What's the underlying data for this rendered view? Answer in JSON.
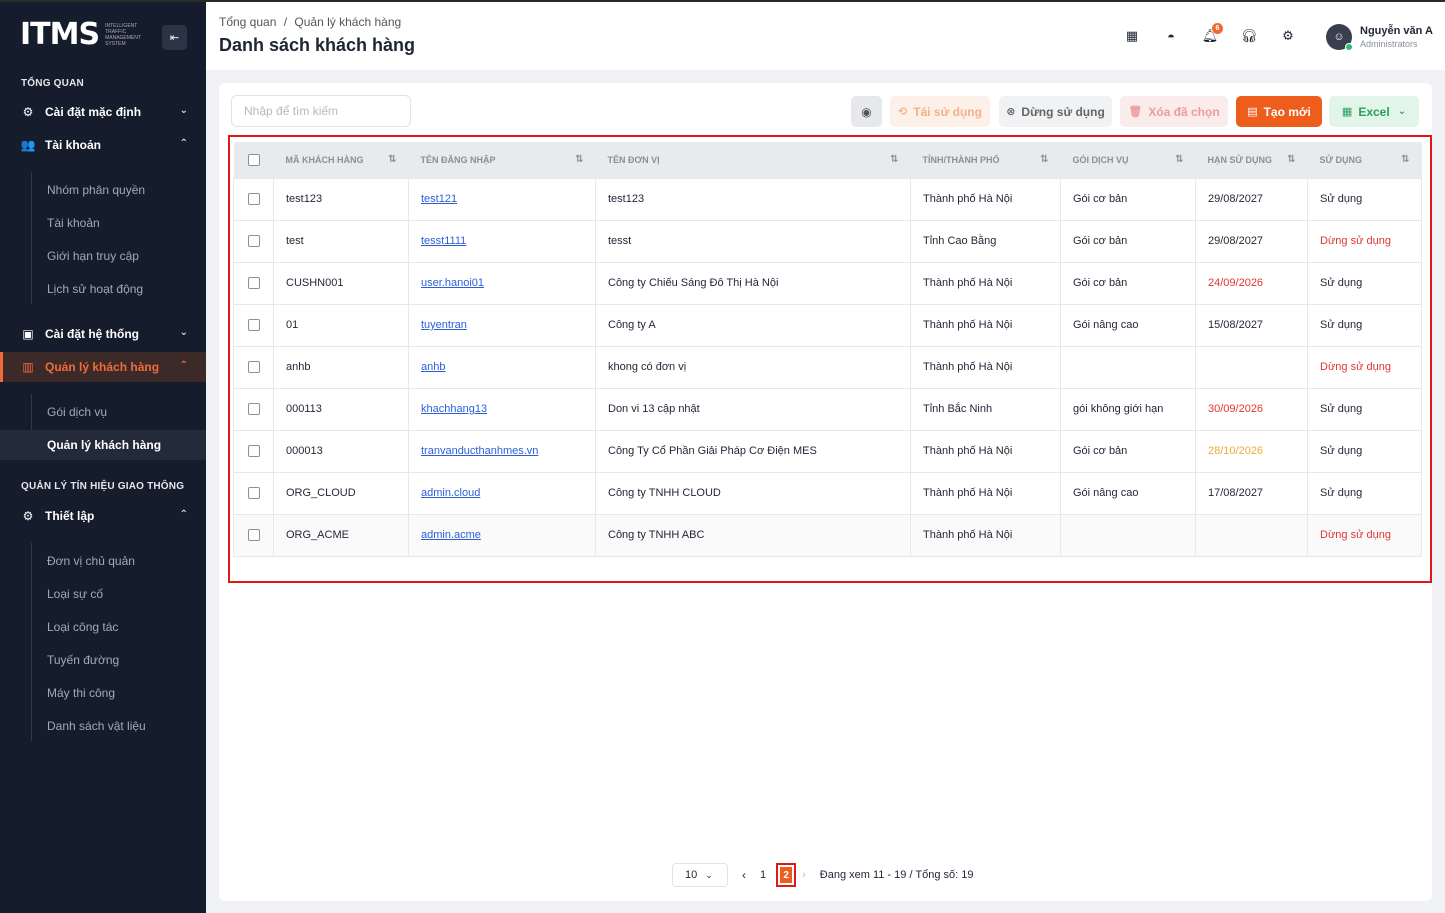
{
  "sidebar": {
    "logo_text": "ITMS",
    "logo_sub": "Intelligent Traffic Management System",
    "section_overview": "TỔNG QUAN",
    "menu_default_settings": "Cài đặt mặc định",
    "menu_account": "Tài khoản",
    "account_items": [
      "Nhóm phân quyền",
      "Tài khoản",
      "Giới hạn truy cập",
      "Lịch sử hoạt động"
    ],
    "menu_system_settings": "Cài đặt hệ thống",
    "menu_customer_mgmt": "Quản lý khách hàng",
    "customer_items": [
      "Gói dịch vụ",
      "Quản lý khách hàng"
    ],
    "section_traffic": "QUẢN LÝ TÍN HIỆU GIAO THÔNG",
    "menu_setup": "Thiết lập",
    "setup_items": [
      "Đơn vị chủ quản",
      "Loại sự cố",
      "Loại công tác",
      "Tuyến đường",
      "Máy thi công",
      "Danh sách vật liệu"
    ]
  },
  "header": {
    "breadcrumb_home": "Tổng quan",
    "breadcrumb_sep": "/",
    "breadcrumb_current": "Quản lý khách hàng",
    "title": "Danh sách khách hàng",
    "notification_count": "6",
    "user_name": "Nguyễn văn A",
    "user_role": "Administrators"
  },
  "toolbar": {
    "search_placeholder": "Nhập để tìm kiếm",
    "reuse_label": "Tái sử dụng",
    "stop_label": "Dừng sử dụng",
    "delete_label": "Xóa đã chọn",
    "new_label": "Tạo mới",
    "excel_label": "Excel"
  },
  "table": {
    "headers": [
      "MÃ KHÁCH HÀNG",
      "TÊN ĐĂNG NHẬP",
      "TÊN ĐƠN VỊ",
      "TỈNH/THÀNH PHỐ",
      "GÓI DỊCH VỤ",
      "HẠN SỬ DỤNG",
      "SỬ DỤNG"
    ],
    "rows": [
      {
        "code": "test123",
        "username": "test121",
        "unit": "test123",
        "province": "Thành phố Hà Nội",
        "package": "Gói cơ bản",
        "expiry": "29/08/2027",
        "expiry_status": "normal",
        "status": "Sử dụng",
        "status_type": "active"
      },
      {
        "code": "test",
        "username": "tesst1111",
        "unit": "tesst",
        "province": "Tỉnh Cao Bằng",
        "package": "Gói cơ bản",
        "expiry": "29/08/2027",
        "expiry_status": "normal",
        "status": "Dừng sử dụng",
        "status_type": "stopped"
      },
      {
        "code": "CUSHN001",
        "username": "user.hanoi01",
        "unit": "Công ty Chiếu Sáng Đô Thị Hà Nội",
        "province": "Thành phố Hà Nội",
        "package": "Gói cơ bản",
        "expiry": "24/09/2026",
        "expiry_status": "danger",
        "status": "Sử dụng",
        "status_type": "active"
      },
      {
        "code": "01",
        "username": "tuyentran",
        "unit": "Công ty A",
        "province": "Thành phố Hà Nội",
        "package": "Gói nâng cao",
        "expiry": "15/08/2027",
        "expiry_status": "normal",
        "status": "Sử dụng",
        "status_type": "active"
      },
      {
        "code": "anhb",
        "username": "anhb",
        "unit": "khong có đơn vị",
        "province": "Thành phố Hà Nội",
        "package": "",
        "expiry": "",
        "expiry_status": "normal",
        "status": "Dừng sử dụng",
        "status_type": "stopped"
      },
      {
        "code": "000113",
        "username": "khachhang13",
        "unit": "Don vi 13 cập nhật",
        "province": "Tỉnh Bắc Ninh",
        "package": "gói không giới hạn",
        "expiry": "30/09/2026",
        "expiry_status": "danger",
        "status": "Sử dụng",
        "status_type": "active"
      },
      {
        "code": "000013",
        "username": "tranvanducthanhmes.vn",
        "unit": "Công Ty Cổ Phần Giải Pháp Cơ Điện MES",
        "province": "Thành phố Hà Nội",
        "package": "Gói cơ bản",
        "expiry": "28/10/2026",
        "expiry_status": "warning",
        "status": "Sử dụng",
        "status_type": "active"
      },
      {
        "code": "ORG_CLOUD",
        "username": "admin.cloud",
        "unit": "Công ty TNHH CLOUD",
        "province": "Thành phố Hà Nội",
        "package": "Gói nâng cao",
        "expiry": "17/08/2027",
        "expiry_status": "normal",
        "status": "Sử dụng",
        "status_type": "active"
      },
      {
        "code": "ORG_ACME",
        "username": "admin.acme",
        "unit": "Công ty TNHH ABC",
        "province": "Thành phố Hà Nội",
        "package": "",
        "expiry": "",
        "expiry_status": "normal",
        "status": "Dừng sử dụng",
        "status_type": "stopped"
      }
    ]
  },
  "pagination": {
    "page_size": "10",
    "pages": [
      "1",
      "2"
    ],
    "current_page": "2",
    "info": "Đang xem 11 - 19 / Tổng số: 19"
  },
  "colors": {
    "accent": "#ee5d1b",
    "sidebar_bg": "#151c2c",
    "danger": "#e03535",
    "warning": "#f0a93a",
    "link": "#2b5fd9"
  }
}
